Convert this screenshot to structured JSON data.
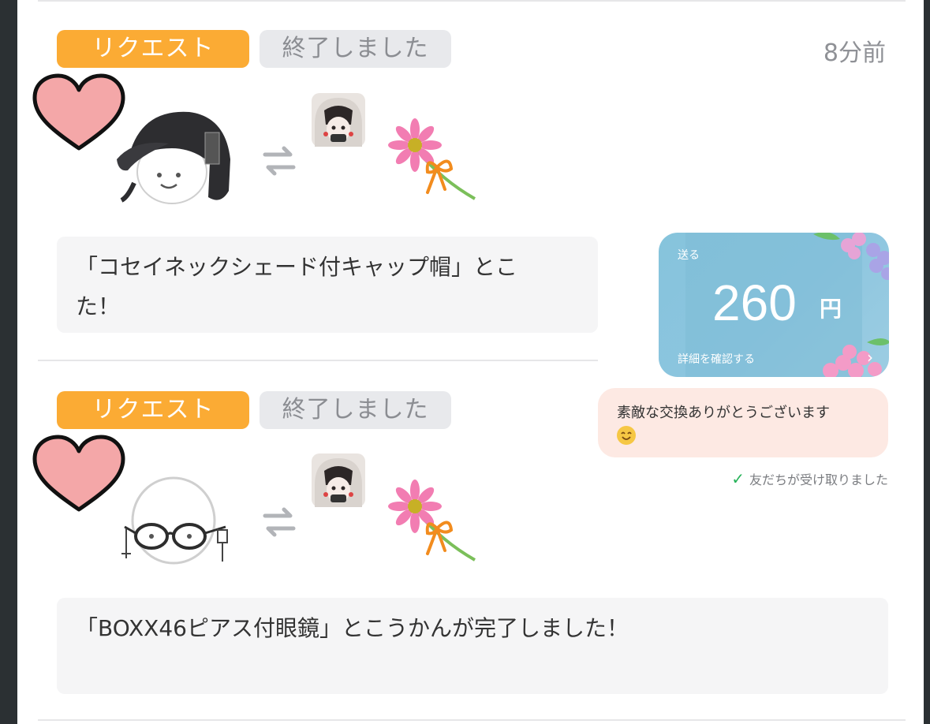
{
  "entries": [
    {
      "badge_request": "リクエスト",
      "badge_status": "終了しました",
      "time": "8分前",
      "message": "「コセイネックシェード付キャップ帽」とこ",
      "message_line2": "た！"
    },
    {
      "badge_request": "リクエスト",
      "badge_status": "終了しました",
      "message": "「BOXX46ピアス付眼鏡」とこうかんが完了しました！"
    }
  ],
  "gift": {
    "label": "送る",
    "amount": "260",
    "unit": "円",
    "detail": "詳細を確認する"
  },
  "chat": {
    "message": "素敵な交換ありがとうございます",
    "status": "友だちが受け取りました"
  },
  "icons": {
    "heart": "heart-icon",
    "swap": "swap-arrows-icon",
    "flower": "flower-icon",
    "check": "check-icon"
  },
  "colors": {
    "request_badge": "#fbab34",
    "status_badge": "#e8e9ec",
    "gift_card": "#8cc5df",
    "chat_bubble": "#fde9e3",
    "check": "#27b35a"
  }
}
